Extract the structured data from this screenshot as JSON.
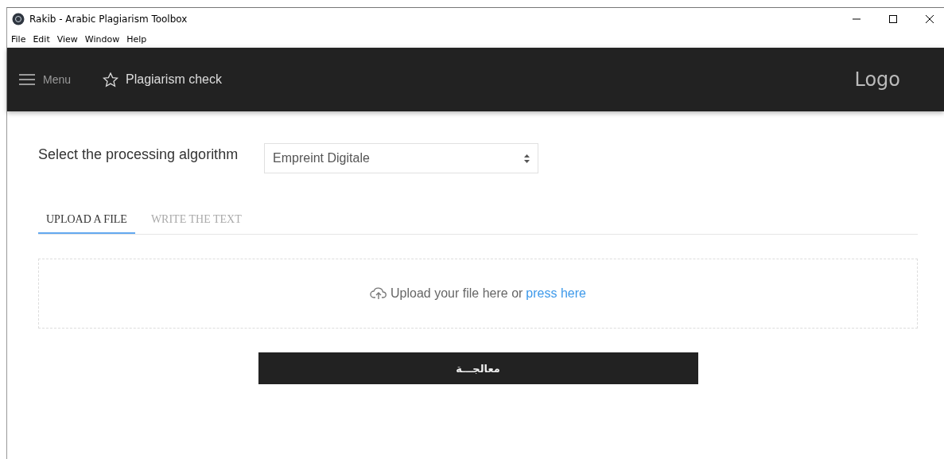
{
  "window": {
    "title": "Rakib - Arabic Plagiarism Toolbox"
  },
  "menu_bar": [
    "File",
    "Edit",
    "View",
    "Window",
    "Help"
  ],
  "header": {
    "menu_label": "Menu",
    "nav_item": "Plagiarism check",
    "logo": "Logo"
  },
  "algorithm": {
    "label": "Select the processing algorithm",
    "value": "Empreint Digitale"
  },
  "tabs": [
    {
      "label": "UPLOAD A FILE",
      "selected": true
    },
    {
      "label": "WRITE THE TEXT",
      "selected": false
    }
  ],
  "upload": {
    "text": "Upload your file here or",
    "link": "press here"
  },
  "submit_button": "معالجـــة"
}
